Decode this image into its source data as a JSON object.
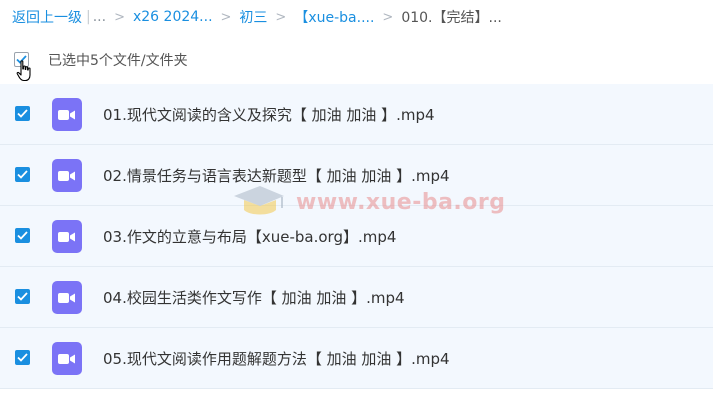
{
  "breadcrumb": {
    "back": "返回上一级",
    "ellipsis": "...",
    "items": [
      "x26 2024...",
      "初三",
      "【xue-ba....",
      "010.【完结】..."
    ]
  },
  "selection": {
    "label": "已选中5个文件/文件夹",
    "all_checked": false
  },
  "files": [
    {
      "name": "01.现代文阅读的含义及探究【 加油 加油 】.mp4",
      "checked": true,
      "icon": "video-file-icon"
    },
    {
      "name": "02.情景任务与语言表达新题型【 加油 加油 】.mp4",
      "checked": true,
      "icon": "video-file-icon"
    },
    {
      "name": "03.作文的立意与布局【xue-ba.org】.mp4",
      "checked": true,
      "icon": "video-file-icon"
    },
    {
      "name": "04.校园生活类作文写作【 加油 加油 】.mp4",
      "checked": true,
      "icon": "video-file-icon"
    },
    {
      "name": "05.现代文阅读作用题解题方法【 加油 加油 】.mp4",
      "checked": true,
      "icon": "video-file-icon"
    }
  ],
  "watermark": {
    "text": "www.xue-ba.org"
  },
  "colors": {
    "accent": "#1a8fe0",
    "file_icon": "#7b73f6",
    "row_bg": "#f3f8fe"
  }
}
